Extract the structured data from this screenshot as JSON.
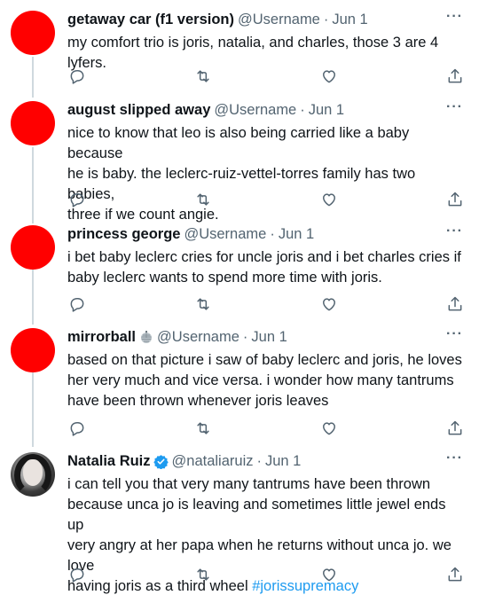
{
  "tweets": [
    {
      "name": "getaway car (f1 version)",
      "handle": "@Username",
      "time": "Jun 1",
      "text": "my comfort trio is joris, natalia, and charles, those 3 are 4 lyfers.",
      "avatar": "red-circle"
    },
    {
      "name": "august slipped away",
      "handle": "@Username",
      "time": "Jun 1",
      "text": "nice to know that leo is also being carried like a baby because\nhe is baby. the leclerc-ruiz-vettel-torres family has two babies,\nthree if we count angie.",
      "avatar": "red-circle"
    },
    {
      "name": "princess george",
      "handle": "@Username",
      "time": "Jun 1",
      "text": "i bet baby leclerc cries for uncle joris and i bet charles cries if\nbaby leclerc wants to spend more time with joris.",
      "avatar": "red-circle"
    },
    {
      "name": "mirrorball",
      "name_emoji": "disco-ball-emoji",
      "handle": "@Username",
      "time": "Jun 1",
      "text": "based on that picture i saw of baby leclerc and joris, he loves\nher very much and vice versa. i wonder how many tantrums\nhave been thrown whenever joris leaves",
      "avatar": "red-circle"
    },
    {
      "name": "Natalia Ruiz",
      "verified": true,
      "handle": "@nataliaruiz",
      "time": "Jun 1",
      "text": "i can tell you that very many tantrums have been thrown\nbecause unca jo is leaving and sometimes little jewel ends up\nvery angry at her papa when he returns without unca jo. we love\nhaving joris as a third wheel ",
      "hashtag": "#jorissupremacy",
      "avatar": "photo"
    }
  ],
  "separator": "·",
  "more_icon": "···",
  "colors": {
    "avatar_red": "#ff0000",
    "text": "#0f1419",
    "muted": "#536471",
    "link": "#1d9bf0",
    "verified": "#1d9bf0"
  },
  "icons": [
    "reply-icon",
    "retweet-icon",
    "like-icon",
    "share-icon"
  ]
}
